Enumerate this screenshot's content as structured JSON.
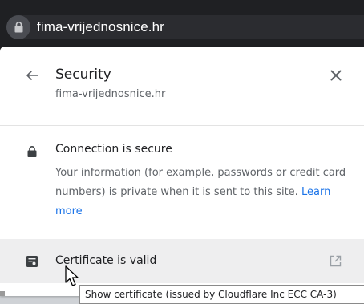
{
  "address_bar": {
    "url": "fima-vrijednosnice.hr",
    "lock_icon": "lock-icon"
  },
  "popup": {
    "title": "Security",
    "site": "fima-vrijednosnice.hr",
    "back_icon": "back-arrow-icon",
    "close_icon": "close-icon"
  },
  "connection": {
    "icon": "lock-icon",
    "title": "Connection is secure",
    "description": "Your information (for example, passwords or credit card numbers) is private when it is sent to this site.",
    "learn_more": "Learn more"
  },
  "certificate": {
    "icon": "certificate-icon",
    "label": "Certificate is valid",
    "external_icon": "external-link-icon"
  },
  "tooltip": {
    "text": "Show certificate (issued by Cloudflare Inc ECC CA-3)"
  },
  "colors": {
    "topbar_bg": "#1f2023",
    "panel_bg": "#ffffff",
    "link": "#1a73e8",
    "highlight_row": "#eeeeef",
    "text_primary": "#202124",
    "text_secondary": "#5f6368"
  }
}
